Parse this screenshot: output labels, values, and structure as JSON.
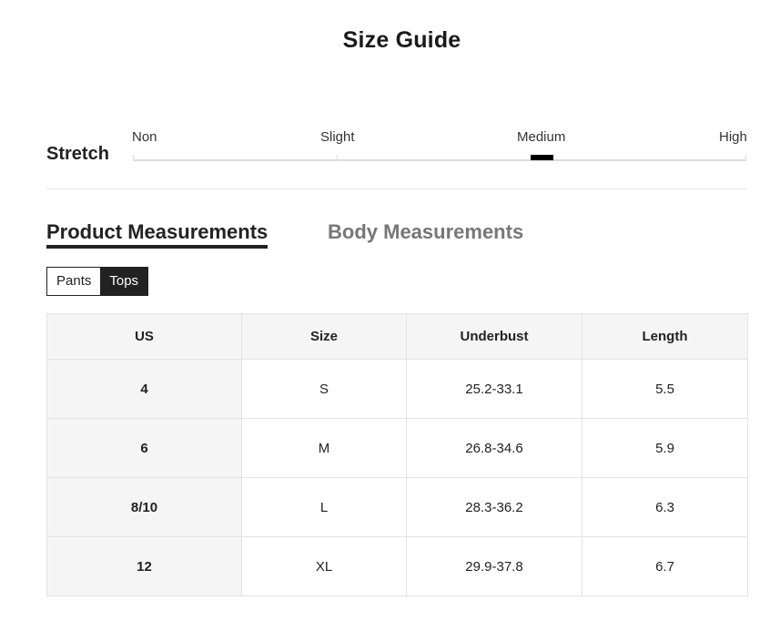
{
  "title": "Size Guide",
  "stretch": {
    "label": "Stretch",
    "levels": [
      "Non",
      "Slight",
      "Medium",
      "High"
    ],
    "selected": "Medium"
  },
  "tabs": [
    {
      "label": "Product Measurements",
      "active": true
    },
    {
      "label": "Body Measurements",
      "active": false
    }
  ],
  "segments": [
    {
      "label": "Pants",
      "active": false
    },
    {
      "label": "Tops",
      "active": true
    }
  ],
  "table": {
    "headers": [
      "US",
      "Size",
      "Underbust",
      "Length"
    ],
    "rows": [
      [
        "4",
        "S",
        "25.2-33.1",
        "5.5"
      ],
      [
        "6",
        "M",
        "26.8-34.6",
        "5.9"
      ],
      [
        "8/10",
        "L",
        "28.3-36.2",
        "6.3"
      ],
      [
        "12",
        "XL",
        "29.9-37.8",
        "6.7"
      ]
    ]
  },
  "colors": {
    "accent": "#222222",
    "inactive_tab": "#777777",
    "header_bg": "#f5f5f5",
    "border": "#e3e3e3"
  }
}
